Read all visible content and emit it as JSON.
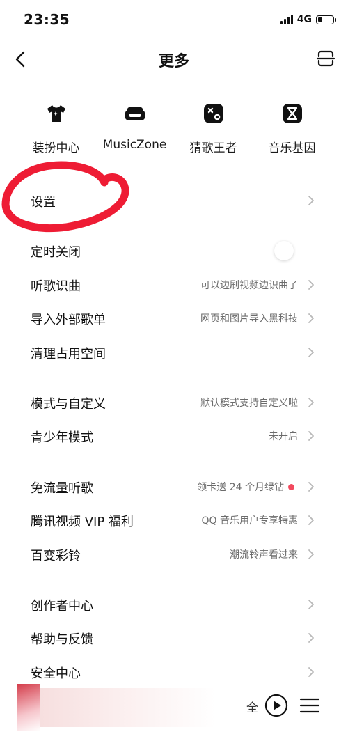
{
  "status_bar": {
    "time": "23:35",
    "network": "4G",
    "icons": [
      "signal-icon",
      "battery-icon"
    ]
  },
  "header": {
    "title": "更多",
    "left_icon": "chevron-left-icon",
    "right_icon": "scan-icon"
  },
  "quick_entries": [
    {
      "label": "装扮中心",
      "icon": "tshirt-icon"
    },
    {
      "label": "MusicZone",
      "icon": "sofa-icon"
    },
    {
      "label": "猜歌王者",
      "icon": "game-tile-icon"
    },
    {
      "label": "音乐基因",
      "icon": "dna-icon"
    }
  ],
  "menu": [
    {
      "label": "设置",
      "value": "",
      "type": "link"
    },
    {
      "label": "定时关闭",
      "value": "",
      "type": "toggle",
      "on": false
    },
    {
      "label": "听歌识曲",
      "value": "可以边刷视频边识曲了",
      "type": "link"
    },
    {
      "label": "导入外部歌单",
      "value": "网页和图片导入黑科技",
      "type": "link"
    },
    {
      "label": "清理占用空间",
      "value": "",
      "type": "link"
    },
    {
      "label": "模式与自定义",
      "value": "默认模式支持自定义啦",
      "type": "link"
    },
    {
      "label": "青少年模式",
      "value": "未开启",
      "type": "link"
    },
    {
      "label": "免流量听歌",
      "value": "领卡送 24 个月绿钻",
      "type": "link",
      "badge_dot": true
    },
    {
      "label": "腾讯视频 VIP 福利",
      "value": "QQ 音乐用户专享特惠",
      "type": "link"
    },
    {
      "label": "百变彩铃",
      "value": "潮流铃声看过来",
      "type": "link"
    },
    {
      "label": "创作者中心",
      "value": "",
      "type": "link"
    },
    {
      "label": "帮助与反馈",
      "value": "",
      "type": "link"
    },
    {
      "label": "安全中心",
      "value": "",
      "type": "link"
    }
  ],
  "mini_player": {
    "track_text": "全",
    "icons": [
      "play-icon",
      "playlist-icon"
    ]
  },
  "colors": {
    "annotation_red": "#ee1c34",
    "dot_red": "#f2495e",
    "text_primary": "#111111",
    "text_secondary": "#6b6b6b",
    "chevron": "#b8b8b8"
  }
}
